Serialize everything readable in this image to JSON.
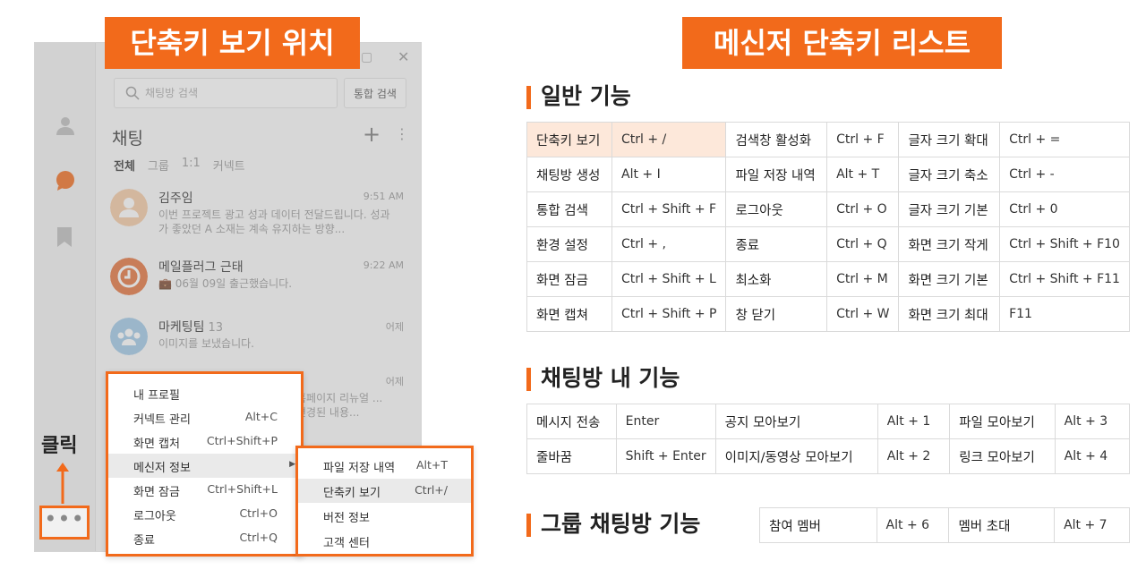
{
  "banners": {
    "left": "단축키 보기 위치",
    "right": "메신저 단축키 리스트"
  },
  "window": {
    "search_placeholder": "채팅방 검색",
    "combined_search": "통합 검색",
    "chat_title": "채팅",
    "filter_tabs": [
      "전체",
      "그룹",
      "1:1",
      "커넥트"
    ],
    "chats": [
      {
        "name": "김주임",
        "count": "",
        "time": "9:51 AM",
        "preview": "이번 프로젝트 광고 성과 데이터 전달드립니다. 성과가 좋았던 A 소재는 계속 유지하는 방향..."
      },
      {
        "name": "메일플러그 근태",
        "count": "",
        "time": "9:22 AM",
        "preview": "💼 06월 09일 출근했습니다."
      },
      {
        "name": "마케팅팀",
        "count": "13",
        "time": "어제",
        "preview": "이미지를 보냈습니다."
      },
      {
        "name": "",
        "count": "",
        "time": "어제",
        "preview": "홈페이지 리뉴얼 ... 변경된 내용..."
      }
    ],
    "click_label": "클릭",
    "more_dots": "•••"
  },
  "main_menu": [
    {
      "label": "내 프로필",
      "shortcut": ""
    },
    {
      "label": "커넥트 관리",
      "shortcut": "Alt+C"
    },
    {
      "label": "화면 캡처",
      "shortcut": "Ctrl+Shift+P"
    },
    {
      "label": "메신저 정보",
      "shortcut": ""
    },
    {
      "label": "화면 잠금",
      "shortcut": "Ctrl+Shift+L"
    },
    {
      "label": "로그아웃",
      "shortcut": "Ctrl+O"
    },
    {
      "label": "종료",
      "shortcut": "Ctrl+Q"
    }
  ],
  "sub_menu": [
    {
      "label": "파일 저장 내역",
      "shortcut": "Alt+T"
    },
    {
      "label": "단축키 보기",
      "shortcut": "Ctrl+/"
    },
    {
      "label": "버전 정보",
      "shortcut": ""
    },
    {
      "label": "고객 센터",
      "shortcut": ""
    }
  ],
  "sections": {
    "general": "일반 기능",
    "chatroom": "채팅방 내 기능",
    "group": "그룹 채팅방 기능"
  },
  "general_rows": [
    [
      "단축키 보기",
      "Ctrl + /",
      "검색창 활성화",
      "Ctrl + F",
      "글자 크기 확대",
      "Ctrl + ="
    ],
    [
      "채팅방 생성",
      "Alt + I",
      "파일 저장 내역",
      "Alt + T",
      "글자 크기 축소",
      "Ctrl + -"
    ],
    [
      "통합 검색",
      "Ctrl + Shift + F",
      "로그아웃",
      "Ctrl + O",
      "글자 크기 기본",
      "Ctrl + 0"
    ],
    [
      "환경 설정",
      "Ctrl + ,",
      "종료",
      "Ctrl + Q",
      "화면 크기 작게",
      "Ctrl + Shift + F10"
    ],
    [
      "화면 잠금",
      "Ctrl + Shift + L",
      "최소화",
      "Ctrl + M",
      "화면 크기 기본",
      "Ctrl + Shift + F11"
    ],
    [
      "화면 캡쳐",
      "Ctrl + Shift + P",
      "창 닫기",
      "Ctrl + W",
      "화면 크기 최대",
      "F11"
    ]
  ],
  "chatroom_rows": [
    [
      "메시지 전송",
      "Enter",
      "공지 모아보기",
      "Alt + 1",
      "파일 모아보기",
      "Alt + 3"
    ],
    [
      "줄바꿈",
      "Shift + Enter",
      "이미지/동영상 모아보기",
      "Alt + 2",
      "링크 모아보기",
      "Alt + 4"
    ]
  ],
  "group_rows": [
    [
      "참여 멤버",
      "Alt + 6",
      "멤버 초대",
      "Alt + 7"
    ]
  ],
  "colors": {
    "accent": "#f26a1b",
    "highlight_cell": "#fde8da"
  }
}
